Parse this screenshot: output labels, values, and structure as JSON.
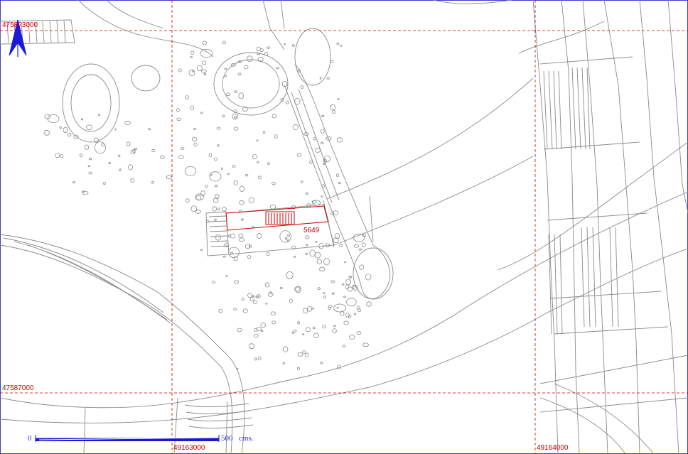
{
  "map": {
    "grid_labels": {
      "north_top": "4758?3000",
      "north_mid": "47587000",
      "east_left": "49163000",
      "east_right": "49164000"
    },
    "feature_label": "5649",
    "scale": {
      "start": "0",
      "end": "500",
      "unit": "cms."
    },
    "colors": {
      "linework": "#8a8a8a",
      "grid": "#cc0000",
      "feature": "#cc0000",
      "north_arrow": "#1a1ad6",
      "scale_bar": "#1a1ad6"
    },
    "icons": {
      "north": "north-arrow-icon"
    }
  }
}
